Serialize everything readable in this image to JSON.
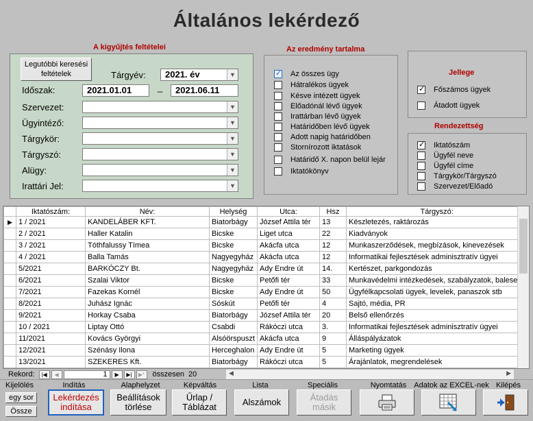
{
  "title": "Általános lekérdező",
  "criteria": {
    "title": "A kigyűjtés feltételei",
    "recent_btn": "Legutóbbi keresési feltételek",
    "year_label": "Tárgyév:",
    "year_value": "2021. év",
    "period_label": "Időszak:",
    "period_from": "2021.01.01",
    "period_sep": "_",
    "period_to": "2021.06.11",
    "fields": [
      "Szervezet:",
      "Ügyintéző:",
      "Tárgykör:",
      "Tárgyszó:",
      "Alügy:",
      "Irattári Jel:"
    ]
  },
  "result": {
    "title": "Az eredmény tartalma",
    "items": [
      {
        "label": "Az összes ügy",
        "checked": true
      },
      {
        "label": "Hátralékos ügyek",
        "checked": false
      },
      {
        "label": "Késve intézett ügyek",
        "checked": false
      },
      {
        "label": "Előadónál lévő ügyek",
        "checked": false
      },
      {
        "label": "Irattárban lévő ügyek",
        "checked": false
      },
      {
        "label": "Határidőben lévő ügyek",
        "checked": false
      },
      {
        "label": "Adott napig határidőben",
        "checked": false
      },
      {
        "label": "Stornírozott iktatások",
        "checked": false
      },
      {
        "label": "Határidő X. napon belül lejár",
        "checked": false
      },
      {
        "label": "Iktatókönyv",
        "checked": false
      }
    ]
  },
  "jellege": {
    "title": "Jellege",
    "items": [
      {
        "label": "Főszámos ügyek",
        "checked": true
      },
      {
        "label": "Átadott ügyek",
        "checked": false
      }
    ]
  },
  "rend": {
    "title": "Rendezettség",
    "items": [
      {
        "label": "Iktatószám",
        "checked": true
      },
      {
        "label": "Ügyfél neve",
        "checked": false
      },
      {
        "label": "Ügyfél címe",
        "checked": false
      },
      {
        "label": "Tárgykör/Tárgyszó",
        "checked": false
      },
      {
        "label": "Szervezet/Előadó",
        "checked": false
      }
    ]
  },
  "grid": {
    "headers": [
      "Iktatószám:",
      "Név:",
      "Helység",
      "Utca:",
      "Hsz",
      "Tárgyszó:"
    ],
    "rows": [
      [
        "1 / 2021",
        "KANDELÁBER KFT.",
        "Biatorbágy",
        "József Attila tér",
        "13",
        "Készletezés, raktározás"
      ],
      [
        "2 / 2021",
        "Haller Katalin",
        "Bicske",
        "Liget utca",
        "22",
        "Kiadványok"
      ],
      [
        "3 / 2021",
        "Tóthfalussy Tímea",
        "Bicske",
        "Akácfa utca",
        "12",
        "Munkaszerződések, megbízások, kinevezések"
      ],
      [
        "4 / 2021",
        "Balla Tamás",
        "Nagyegyház",
        "Akácfa utca",
        "12",
        "Informatikai fejlesztések adminisztratív ügyei"
      ],
      [
        "5/2021",
        "BARKÓCZY Bt.",
        "Nagyegyház",
        "Ady Endre út",
        "14.",
        "Kertészet, parkgondozás"
      ],
      [
        "6/2021",
        "Szalai Viktor",
        "Bicske",
        "Petőfi tér",
        "33",
        "Munkavédelmi intézkedések, szabályzatok, baleseti j"
      ],
      [
        "7/2021",
        "Fazekas Kornél",
        "Bicske",
        "Ady Endre út",
        "50",
        "Ügyfélkapcsolati ügyek, levelek, panaszok stb"
      ],
      [
        "8/2021",
        "Juhász Ignác",
        "Sóskút",
        "Petőfi tér",
        "4",
        "Sajtó, média, PR"
      ],
      [
        "9/2021",
        "Horkay Csaba",
        "Biatorbágy",
        "József Attila tér",
        "20",
        "Belső ellenőrzés"
      ],
      [
        "10 / 2021",
        "Liptay Ottó",
        "Csabdi",
        "Rákóczi utca",
        "3.",
        "Informatikai fejlesztések adminisztratív ügyei"
      ],
      [
        "11/2021",
        "Kovács Györgyi",
        "Alsóörspuszt",
        "Akácfa utca",
        "9",
        "Álláspályázatok"
      ],
      [
        "12/2021",
        "Szénásy Ilona",
        "Herceghalon",
        "Ady Endre út",
        "5",
        "Marketing ügyek"
      ],
      [
        "13/2021",
        "SZEKERES Kft.",
        "Biatorbágy",
        "Rákóczi utca",
        "5",
        "Árajánlatok, megrendelések"
      ]
    ]
  },
  "nav": {
    "label": "Rekord:",
    "current": "1",
    "total_label": "összesen",
    "total": "20"
  },
  "bottom": {
    "kijeloles": "Kijelölés",
    "egy_sor": "egy sor",
    "ossze": "Össze",
    "inditas": "Indítás",
    "inditas_btn": "Lekérdezés indítása",
    "alaphelyzet": "Alaphelyzet",
    "alaphelyzet_btn": "Beállítások törlése",
    "kepvaltas": "Képváltás",
    "kepvaltas_btn": "Űrlap / Táblázat",
    "lista": "Lista",
    "lista_btn": "Alszámok",
    "specialis": "Speciális műveletek",
    "specialis_btn": "Átadás másik",
    "nyomtatas": "Nyomtatás",
    "excel": "Adatok az EXCEL-nek",
    "kilepes": "Kilépés"
  }
}
